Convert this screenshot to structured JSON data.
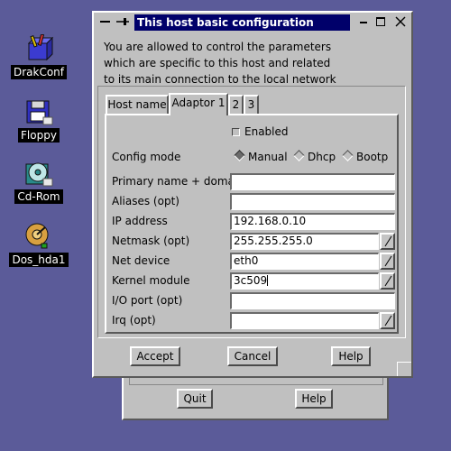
{
  "desktop": {
    "icons": [
      {
        "label": "DrakConf"
      },
      {
        "label": "Floppy"
      },
      {
        "label": "Cd-Rom"
      },
      {
        "label": "Dos_hda1"
      }
    ]
  },
  "back_window": {
    "quit_label": "Quit",
    "help_label": "Help"
  },
  "dialog": {
    "title": "This host basic configuration",
    "intro_lines": [
      "You are allowed to control the parameters",
      "which are specific to this host and related",
      "to its main connection to the local network"
    ],
    "tabs": [
      {
        "label": "Host name"
      },
      {
        "label": "Adaptor 1",
        "active": true
      },
      {
        "label": "2"
      },
      {
        "label": "3"
      }
    ],
    "enabled": {
      "label": "Enabled",
      "checked": false
    },
    "config_mode": {
      "label": "Config mode",
      "options": [
        "Manual",
        "Dhcp",
        "Bootp"
      ],
      "selected": "Manual"
    },
    "fields": [
      {
        "label": "Primary name + domain",
        "value": ""
      },
      {
        "label": "Aliases (opt)",
        "value": ""
      },
      {
        "label": "IP address",
        "value": "192.168.0.10"
      },
      {
        "label": "Netmask (opt)",
        "value": "255.255.255.0"
      },
      {
        "label": "Net device",
        "value": "eth0"
      },
      {
        "label": "Kernel module",
        "value": "3c509"
      },
      {
        "label": "I/O port (opt)",
        "value": ""
      },
      {
        "label": "Irq (opt)",
        "value": ""
      }
    ],
    "buttons": {
      "accept": "Accept",
      "cancel": "Cancel",
      "help": "Help"
    }
  }
}
